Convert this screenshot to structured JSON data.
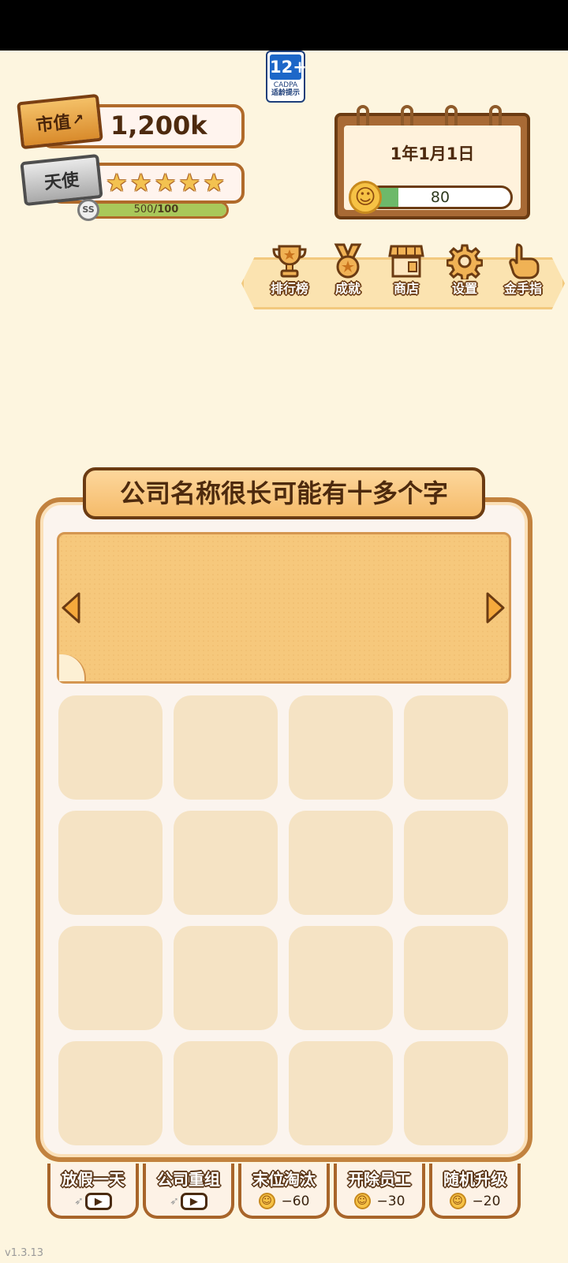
{
  "age_rating": {
    "number": "12+",
    "org": "CADPA",
    "tip": "适龄提示"
  },
  "market_value": {
    "tag": "市值",
    "value": "1,200k"
  },
  "rank": {
    "tag": "天使",
    "stars": 5,
    "grade": "SS",
    "xp_current": "500",
    "xp_total": "/100",
    "xp_fraction": 1.0
  },
  "calendar": {
    "date": "1年1月1日",
    "mood_value": "80",
    "mood_fraction": 0.2
  },
  "menu": [
    {
      "label": "排行榜",
      "icon": "trophy-icon"
    },
    {
      "label": "成就",
      "icon": "medal-icon"
    },
    {
      "label": "商店",
      "icon": "shop-icon"
    },
    {
      "label": "设置",
      "icon": "gear-icon"
    },
    {
      "label": "金手指",
      "icon": "pointing-hand-icon"
    }
  ],
  "company": {
    "name": "公司名称很长可能有十多个字",
    "slots": 16
  },
  "actions": [
    {
      "label": "放假一天",
      "type": "video"
    },
    {
      "label": "公司重组",
      "type": "video"
    },
    {
      "label": "末位淘汰",
      "type": "cost",
      "cost": "−60"
    },
    {
      "label": "开除员工",
      "type": "cost",
      "cost": "−30"
    },
    {
      "label": "随机升级",
      "type": "cost",
      "cost": "−20"
    }
  ],
  "version": "v1.3.13",
  "colors": {
    "background": "#fdf5df",
    "board_border": "#c2823e",
    "slot": "#f5e3c4",
    "mood_green": "#6db96a"
  }
}
